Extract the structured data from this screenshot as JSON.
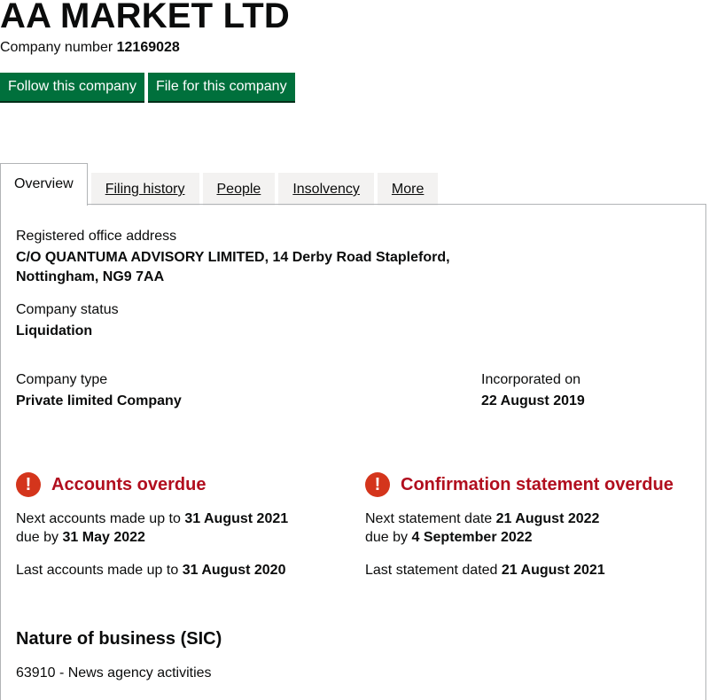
{
  "company": {
    "name": "AA MARKET LTD",
    "number_label": "Company number",
    "number": "12169028"
  },
  "buttons": {
    "follow": "Follow this company",
    "file": "File for this company"
  },
  "tabs": [
    {
      "label": "Overview"
    },
    {
      "label": "Filing history"
    },
    {
      "label": "People"
    },
    {
      "label": "Insolvency"
    },
    {
      "label": "More"
    }
  ],
  "overview": {
    "address_label": "Registered office address",
    "address_line1": "C/O QUANTUMA ADVISORY LIMITED, 14 Derby Road Stapleford,",
    "address_line2": "Nottingham, NG9 7AA",
    "status_label": "Company status",
    "status": "Liquidation",
    "type_label": "Company type",
    "type": "Private limited Company",
    "incorporated_label": "Incorporated on",
    "incorporated": "22 August 2019"
  },
  "accounts": {
    "heading": "Accounts overdue",
    "next_prefix": "Next accounts made up to",
    "next_date": "31 August 2021",
    "due_prefix": "due by",
    "due_date": "31 May 2022",
    "last_prefix": "Last accounts made up to",
    "last_date": "31 August 2020"
  },
  "confirmation": {
    "heading": "Confirmation statement overdue",
    "next_prefix": "Next statement date",
    "next_date": "21 August 2022",
    "due_prefix": "due by",
    "due_date": "4 September 2022",
    "last_prefix": "Last statement dated",
    "last_date": "21 August 2021"
  },
  "sic": {
    "heading": "Nature of business (SIC)",
    "item": "63910 - News agency activities"
  },
  "icons": {
    "alert": "exclamation-icon"
  },
  "colors": {
    "button_green": "#00703c",
    "alert_red": "#d4351c",
    "alert_text": "#b10e1e"
  }
}
